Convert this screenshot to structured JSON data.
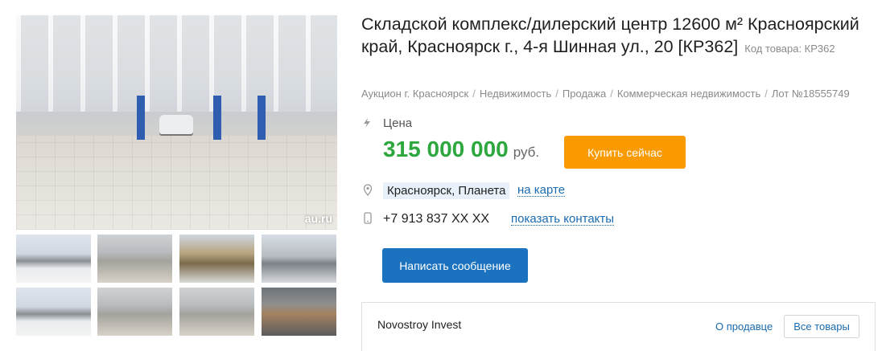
{
  "listing": {
    "title": "Складской комплекс/дилерский центр 12600 м² Красноярский край, Красноярск г., 4-я Шинная ул., 20 [КР362]",
    "code_label": "Код товара: КР362"
  },
  "gallery": {
    "watermark": "au.ru",
    "thumbnails": [
      "snowy-building",
      "showroom-hall",
      "autumn-building",
      "building-facade",
      "snowy-lot",
      "showroom-interior",
      "showroom-cars",
      "garage-interior"
    ]
  },
  "breadcrumb": [
    "Аукцион г. Красноярск",
    "Недвижимость",
    "Продажа",
    "Коммерческая недвижимость",
    "Лот №18555749"
  ],
  "breadcrumb_separator": "/",
  "price": {
    "label": "Цена",
    "amount": "315 000 000",
    "currency": "руб.",
    "buy_button": "Купить сейчас"
  },
  "location": {
    "text": "Красноярск, Планета",
    "map_link": "на карте"
  },
  "contact": {
    "phone": "+7 913 837 XX XX",
    "show_contacts_link": "показать контакты",
    "message_button": "Написать сообщение"
  },
  "seller": {
    "name": "Novostroy Invest",
    "about_link": "О продавце",
    "all_goods_button": "Все товары"
  },
  "colors": {
    "price_green": "#2ea83e",
    "buy_orange": "#f89a00",
    "message_blue": "#1b73c0",
    "link_blue": "#1a6bb0"
  },
  "icons": {
    "price": "lightning-icon",
    "location": "map-pin-icon",
    "phone": "mobile-phone-icon"
  }
}
